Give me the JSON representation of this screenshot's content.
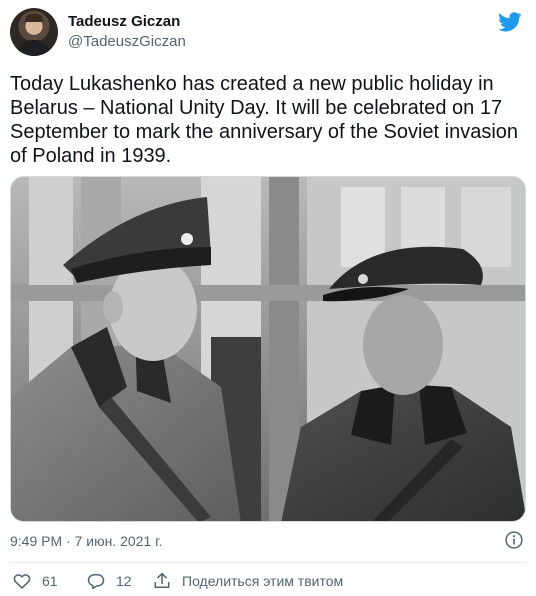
{
  "author": {
    "name": "Tadeusz Giczan",
    "handle": "@TadeuszGiczan"
  },
  "tweet": {
    "text": "Today Lukashenko has created a new public holiday in Belarus – National Unity Day. It will be celebrated on 17 September to mark the anniversary of the Soviet invasion of Poland in 1939.",
    "timestamp": "9:49 PM · 7 июн. 2021 г."
  },
  "media": {
    "type": "black-and-white photo",
    "alt": ""
  },
  "actions": {
    "like_count": "61",
    "reply_count": "12",
    "share_label": "Поделиться этим твитом"
  },
  "icons": {
    "brand": "twitter-bird-icon",
    "info": "info-icon",
    "like": "heart-icon",
    "reply": "reply-icon",
    "share": "share-icon"
  },
  "colors": {
    "brand": "#1d9bf0",
    "text_primary": "#0f1419",
    "text_secondary": "#536471",
    "divider": "#e6ecf0"
  }
}
